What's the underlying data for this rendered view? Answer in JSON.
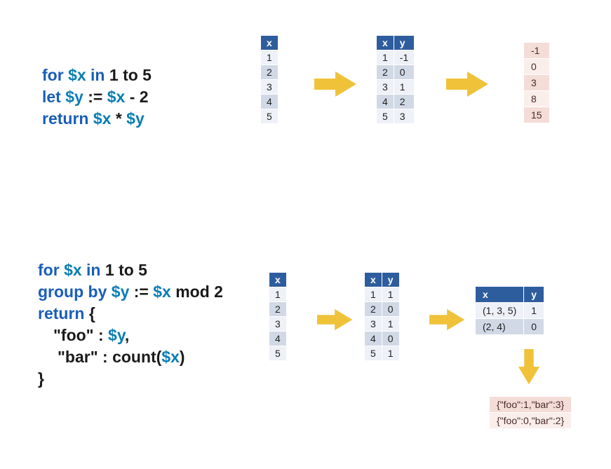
{
  "example1": {
    "code": {
      "line1": {
        "kw": "for",
        "var": "$x",
        "kw2": "in",
        "rest": "1 to 5"
      },
      "line2": {
        "kw": "let",
        "var": "$y",
        "rest_a": ":=",
        "var2": "$x",
        "rest_b": "- 2"
      },
      "line3": {
        "kw": "return",
        "var": "$x",
        "rest_a": "*",
        "var2": "$y"
      }
    },
    "table1": {
      "headers": [
        "x"
      ],
      "rows": [
        [
          1
        ],
        [
          2
        ],
        [
          3
        ],
        [
          4
        ],
        [
          5
        ]
      ]
    },
    "table2": {
      "headers": [
        "x",
        "y"
      ],
      "rows": [
        [
          1,
          -1
        ],
        [
          2,
          0
        ],
        [
          3,
          1
        ],
        [
          4,
          2
        ],
        [
          5,
          3
        ]
      ]
    },
    "result": {
      "rows": [
        [
          -1
        ],
        [
          0
        ],
        [
          3
        ],
        [
          8
        ],
        [
          15
        ]
      ]
    }
  },
  "example2": {
    "code": {
      "line1": {
        "kw": "for",
        "var": "$x",
        "kw2": "in",
        "rest": "1 to 5"
      },
      "line2": {
        "kw": "group by",
        "var": "$y",
        "rest_a": ":=",
        "var2": "$x",
        "rest_b": "mod 2"
      },
      "line3": {
        "kw": "return",
        "rest": "{"
      },
      "line4": {
        "key": "\"foo\"",
        "colon": ":",
        "var": "$y",
        "comma": ","
      },
      "line5": {
        "key": "\"bar\"",
        "colon": ":",
        "fn": "count(",
        "var": "$x",
        "close": ")"
      },
      "line6": {
        "brace": "}"
      }
    },
    "table1": {
      "headers": [
        "x"
      ],
      "rows": [
        [
          1
        ],
        [
          2
        ],
        [
          3
        ],
        [
          4
        ],
        [
          5
        ]
      ]
    },
    "table2": {
      "headers": [
        "x",
        "y"
      ],
      "rows": [
        [
          1,
          1
        ],
        [
          2,
          0
        ],
        [
          3,
          1
        ],
        [
          4,
          0
        ],
        [
          5,
          1
        ]
      ]
    },
    "table3": {
      "headers": [
        "x",
        "y"
      ],
      "rows": [
        [
          "(1, 3, 5)",
          1
        ],
        [
          "(2, 4)",
          0
        ]
      ]
    },
    "result": {
      "rows": [
        [
          "{\"foo\":1,\"bar\":3}"
        ],
        [
          "{\"foo\":0,\"bar\":2}"
        ]
      ]
    }
  }
}
